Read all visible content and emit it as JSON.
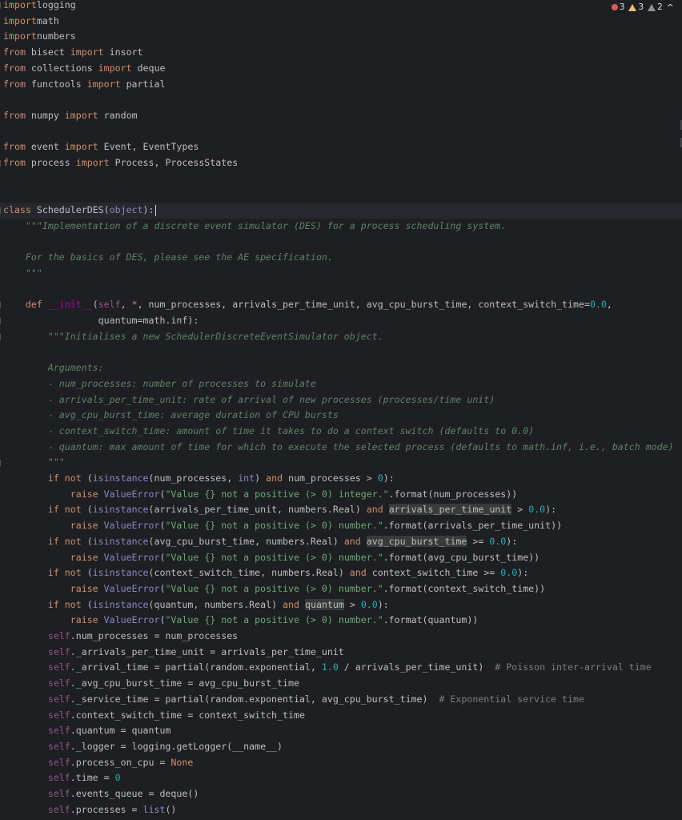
{
  "inspections": {
    "errors": "3",
    "warnings": "3",
    "weak_warnings": "2",
    "error_icon": "error-circle-icon",
    "warning_icon": "warning-triangle-icon",
    "weak_warning_icon": "weak-warning-triangle-icon",
    "navigate_icon": "chevron-up-icon",
    "chevron": "^"
  },
  "colors": {
    "background": "#1e1f22",
    "keyword": "#cf8e6d",
    "string": "#6aab73",
    "number": "#2aacb8",
    "comment": "#7a7e85",
    "docstring": "#5f826b",
    "self": "#94558d"
  },
  "code_lines": [
    [
      [
        "kw",
        "import"
      ],
      [
        "",
        "logging"
      ]
    ],
    [
      [
        "kw",
        "import"
      ],
      [
        "",
        "math"
      ]
    ],
    [
      [
        "kw",
        "import"
      ],
      [
        "",
        "numbers"
      ]
    ],
    [
      [
        "kw",
        "from"
      ],
      [
        "",
        " bisect "
      ],
      [
        "kw",
        "import"
      ],
      [
        "",
        " insort"
      ]
    ],
    [
      [
        "kw",
        "from"
      ],
      [
        "",
        " collections "
      ],
      [
        "kw",
        "import"
      ],
      [
        "",
        " deque"
      ]
    ],
    [
      [
        "kw",
        "from"
      ],
      [
        "",
        " functools "
      ],
      [
        "kw",
        "import"
      ],
      [
        "",
        " partial"
      ]
    ],
    [],
    [
      [
        "kw",
        "from"
      ],
      [
        "",
        " numpy "
      ],
      [
        "kw",
        "import"
      ],
      [
        "",
        " random"
      ]
    ],
    [],
    [
      [
        "kw",
        "from"
      ],
      [
        "",
        " event "
      ],
      [
        "kw",
        "import"
      ],
      [
        "",
        " Event, EventTypes"
      ]
    ],
    [
      [
        "kw",
        "from"
      ],
      [
        "",
        " process "
      ],
      [
        "kw",
        "import"
      ],
      [
        "",
        " Process, ProcessStates"
      ]
    ],
    [],
    [],
    [
      [
        "kw",
        "class"
      ],
      [
        "",
        " SchedulerDES("
      ],
      [
        "bi",
        "object"
      ],
      [
        "",
        "):"
      ]
    ],
    [
      [
        "ds",
        "    \"\"\"Implementation of a discrete event simulator (DES) for a process scheduling system."
      ]
    ],
    [],
    [
      [
        "ds",
        "    For the basics of DES, please see the AE specification."
      ]
    ],
    [
      [
        "ds",
        "    \"\"\""
      ]
    ],
    [],
    [
      [
        "kw",
        "    def"
      ],
      [
        "",
        " "
      ],
      [
        "dn",
        "__init__"
      ],
      [
        "",
        "("
      ],
      [
        "sf",
        "self"
      ],
      [
        "",
        ", "
      ],
      [
        "kw",
        "*"
      ],
      [
        "",
        ", num_processes, arrivals_per_time_unit, avg_cpu_burst_time, context_switch_time="
      ],
      [
        "nu",
        "0.0"
      ],
      [
        "",
        ","
      ]
    ],
    [
      [
        "",
        "                 quantum=math.inf):"
      ]
    ],
    [
      [
        "ds",
        "        \"\"\"Initialises a new SchedulerDiscreteEventSimulator object."
      ]
    ],
    [],
    [
      [
        "ds",
        "        Arguments:"
      ]
    ],
    [
      [
        "ds",
        "        - num_processes: number of processes to simulate"
      ]
    ],
    [
      [
        "ds",
        "        - arrivals_per_time_unit: rate of arrival of new processes (processes/time unit)"
      ]
    ],
    [
      [
        "ds",
        "        - avg_cpu_burst_time: average duration of CPU bursts"
      ]
    ],
    [
      [
        "ds",
        "        - context_switch_time: amount of time it takes to do a context switch (defaults to 0.0)"
      ]
    ],
    [
      [
        "ds",
        "        - quantum: max amount of time for which to execute the selected process (defaults to math.inf, i.e., batch mode)"
      ]
    ],
    [
      [
        "ds",
        "        \"\"\""
      ]
    ],
    [
      [
        "kw",
        "        if not"
      ],
      [
        "",
        " ("
      ],
      [
        "bi",
        "isinstance"
      ],
      [
        "",
        "(num_processes, "
      ],
      [
        "bi",
        "int"
      ],
      [
        "",
        ") "
      ],
      [
        "kw",
        "and"
      ],
      [
        "",
        " num_processes > "
      ],
      [
        "nu",
        "0"
      ],
      [
        "",
        "):"
      ]
    ],
    [
      [
        "",
        "            "
      ],
      [
        "kw",
        "raise"
      ],
      [
        "",
        " "
      ],
      [
        "bi",
        "ValueError"
      ],
      [
        "",
        "("
      ],
      [
        "st",
        "\"Value {} not a positive (> 0) integer.\""
      ],
      [
        "",
        ".format(num_processes))"
      ]
    ],
    [
      [
        "kw",
        "        if not"
      ],
      [
        "",
        " ("
      ],
      [
        "bi",
        "isinstance"
      ],
      [
        "",
        "(arrivals_per_time_unit, numbers.Real) "
      ],
      [
        "kw",
        "and"
      ],
      [
        "",
        " "
      ],
      [
        "hl",
        "arrivals_per_time_unit"
      ],
      [
        "",
        " > "
      ],
      [
        "nu",
        "0.0"
      ],
      [
        "",
        "):"
      ]
    ],
    [
      [
        "",
        "            "
      ],
      [
        "kw",
        "raise"
      ],
      [
        "",
        " "
      ],
      [
        "bi",
        "ValueError"
      ],
      [
        "",
        "("
      ],
      [
        "st",
        "\"Value {} not a positive (> 0) number.\""
      ],
      [
        "",
        ".format(arrivals_per_time_unit))"
      ]
    ],
    [
      [
        "kw",
        "        if not"
      ],
      [
        "",
        " ("
      ],
      [
        "bi",
        "isinstance"
      ],
      [
        "",
        "(avg_cpu_burst_time, numbers.Real) "
      ],
      [
        "kw",
        "and"
      ],
      [
        "",
        " "
      ],
      [
        "hl",
        "avg_cpu_burst_time"
      ],
      [
        "",
        " >= "
      ],
      [
        "nu",
        "0.0"
      ],
      [
        "",
        "):"
      ]
    ],
    [
      [
        "",
        "            "
      ],
      [
        "kw",
        "raise"
      ],
      [
        "",
        " "
      ],
      [
        "bi",
        "ValueError"
      ],
      [
        "",
        "("
      ],
      [
        "st",
        "\"Value {} not a positive (> 0) number.\""
      ],
      [
        "",
        ".format(avg_cpu_burst_time))"
      ]
    ],
    [
      [
        "kw",
        "        if not"
      ],
      [
        "",
        " ("
      ],
      [
        "bi",
        "isinstance"
      ],
      [
        "",
        "(context_switch_time, numbers.Real) "
      ],
      [
        "kw",
        "and"
      ],
      [
        "",
        " context_switch_time >= "
      ],
      [
        "nu",
        "0.0"
      ],
      [
        "",
        "):"
      ]
    ],
    [
      [
        "",
        "            "
      ],
      [
        "kw",
        "raise"
      ],
      [
        "",
        " "
      ],
      [
        "bi",
        "ValueError"
      ],
      [
        "",
        "("
      ],
      [
        "st",
        "\"Value {} not a positive (> 0) number.\""
      ],
      [
        "",
        ".format(context_switch_time))"
      ]
    ],
    [
      [
        "kw",
        "        if not"
      ],
      [
        "",
        " ("
      ],
      [
        "bi",
        "isinstance"
      ],
      [
        "",
        "(quantum, numbers.Real) "
      ],
      [
        "kw",
        "and"
      ],
      [
        "",
        " "
      ],
      [
        "hl",
        "quantum"
      ],
      [
        "",
        " > "
      ],
      [
        "nu",
        "0.0"
      ],
      [
        "",
        "):"
      ]
    ],
    [
      [
        "",
        "            "
      ],
      [
        "kw",
        "raise"
      ],
      [
        "",
        " "
      ],
      [
        "bi",
        "ValueError"
      ],
      [
        "",
        "("
      ],
      [
        "st",
        "\"Value {} not a positive (> 0) number.\""
      ],
      [
        "",
        ".format(quantum))"
      ]
    ],
    [
      [
        "sf",
        "        self"
      ],
      [
        "",
        ".num_processes = num_processes"
      ]
    ],
    [
      [
        "sf",
        "        self"
      ],
      [
        "",
        "._arrivals_per_time_unit = arrivals_per_time_unit"
      ]
    ],
    [
      [
        "sf",
        "        self"
      ],
      [
        "",
        "._arrival_time = partial(random.exponential, "
      ],
      [
        "nu",
        "1.0"
      ],
      [
        "",
        " / arrivals_per_time_unit)  "
      ],
      [
        "cm",
        "# Poisson inter-arrival time"
      ]
    ],
    [
      [
        "sf",
        "        self"
      ],
      [
        "",
        "._avg_cpu_burst_time = avg_cpu_burst_time"
      ]
    ],
    [
      [
        "sf",
        "        self"
      ],
      [
        "",
        "._service_time = partial(random.exponential, avg_cpu_burst_time)  "
      ],
      [
        "cm",
        "# Exponential service time"
      ]
    ],
    [
      [
        "sf",
        "        self"
      ],
      [
        "",
        ".context_switch_time = context_switch_time"
      ]
    ],
    [
      [
        "sf",
        "        self"
      ],
      [
        "",
        ".quantum = quantum"
      ]
    ],
    [
      [
        "sf",
        "        self"
      ],
      [
        "",
        "._logger = logging.getLogger(__name__)"
      ]
    ],
    [
      [
        "sf",
        "        self"
      ],
      [
        "",
        ".process_on_cpu = "
      ],
      [
        "kw",
        "None"
      ]
    ],
    [
      [
        "sf",
        "        self"
      ],
      [
        "",
        ".time = "
      ],
      [
        "nu",
        "0"
      ]
    ],
    [
      [
        "sf",
        "        self"
      ],
      [
        "",
        ".events_queue = deque()"
      ]
    ],
    [
      [
        "sf",
        "        self"
      ],
      [
        "",
        ".processes = "
      ],
      [
        "bi",
        "list"
      ],
      [
        "",
        "()"
      ]
    ]
  ]
}
